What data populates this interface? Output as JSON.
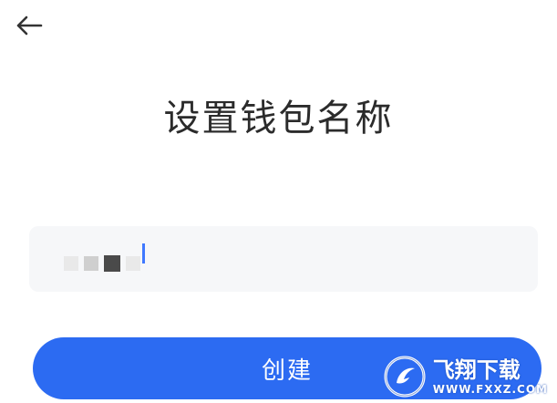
{
  "header": {
    "back_icon": "arrow-left-icon"
  },
  "page": {
    "title": "设置钱包名称"
  },
  "wallet_name_input": {
    "value": "",
    "placeholder": ""
  },
  "actions": {
    "create_label": "创建"
  },
  "watermark": {
    "cn": "飞翔下载",
    "en": "WWW.FXXZ.COM"
  },
  "colors": {
    "accent": "#2c6bf2",
    "field_bg": "#f6f7f9",
    "title": "#2b2b2b"
  }
}
